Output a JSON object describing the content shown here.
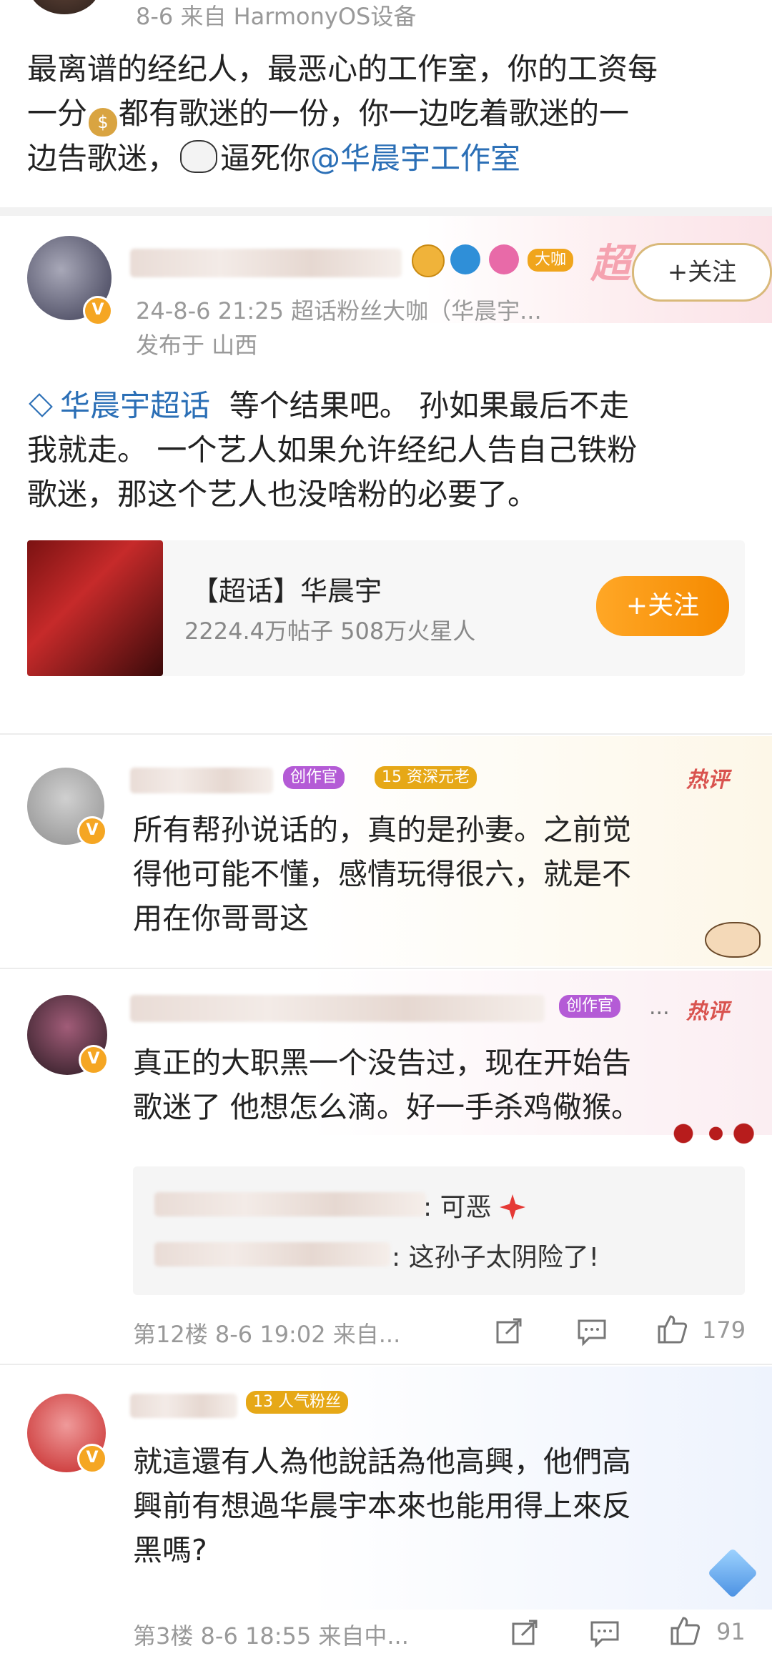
{
  "post": {
    "meta": "8-6  来自 HarmonyOS设备",
    "text_a": "最离谱的经纪人，最恶心的工作室，你的工资每",
    "text_b": "一分",
    "text_c": "都有歌迷的一份，你一边吃着歌迷的一",
    "text_d": "边告歌迷，",
    "text_e": "逼死你",
    "mention": "@华晨宇工作室"
  },
  "retweet": {
    "badge_dk": "大咖",
    "chao": "超",
    "follow_label": "+关注",
    "meta_line1": "24-8-6 21:25  超话粉丝大咖（华晨宇...",
    "meta_line2": "发布于 山西",
    "topic_link": "华晨宇超话",
    "text_1": "等个结果吧。 孙如果最后不走",
    "text_2": "我就走。 一个艺人如果允许经纪人告自己铁粉",
    "text_3": "歌迷，那这个艺人也没啥粉的必要了。",
    "card": {
      "title": "【超话】华晨宇",
      "stats": "2224.4万帖子 508万火星人",
      "follow_label": "+关注"
    }
  },
  "comments": [
    {
      "badge1": "创作官",
      "badge2_num": "15",
      "badge2": "资深元老",
      "hot": "热评",
      "lines": [
        "所有帮孙说话的，真的是孙妻。之前觉",
        "得他可能不懂，感情玩得很六，就是不",
        "用在你哥哥这"
      ]
    },
    {
      "badge1": "创作官",
      "more": "...",
      "hot": "热评",
      "lines": [
        "真正的大职黑一个没告过，现在开始告",
        "歌迷了 他想怎么滴。好一手杀鸡儆猴。"
      ],
      "replies": [
        {
          "text": ": 可恶"
        },
        {
          "text": ": 这孙子太阴险了!"
        }
      ],
      "footer": {
        "floor": "第12楼  8-6 19:02  来自...",
        "likes": "179"
      }
    },
    {
      "badge_num": "13",
      "badge": "人气粉丝",
      "lines": [
        "就這還有人為他說話為他高興，他們高",
        "興前有想過华晨宇本來也能用得上來反",
        "黑嗎?"
      ],
      "footer": {
        "floor": "第3楼  8-6 18:55  来自中...",
        "likes": "91"
      }
    }
  ],
  "colors": {
    "link": "#2b6fb6",
    "orange": "#f79a1e",
    "hot_red": "#d9534f",
    "purple_badge": "#b45bd6",
    "gold_badge": "#e6a817"
  }
}
